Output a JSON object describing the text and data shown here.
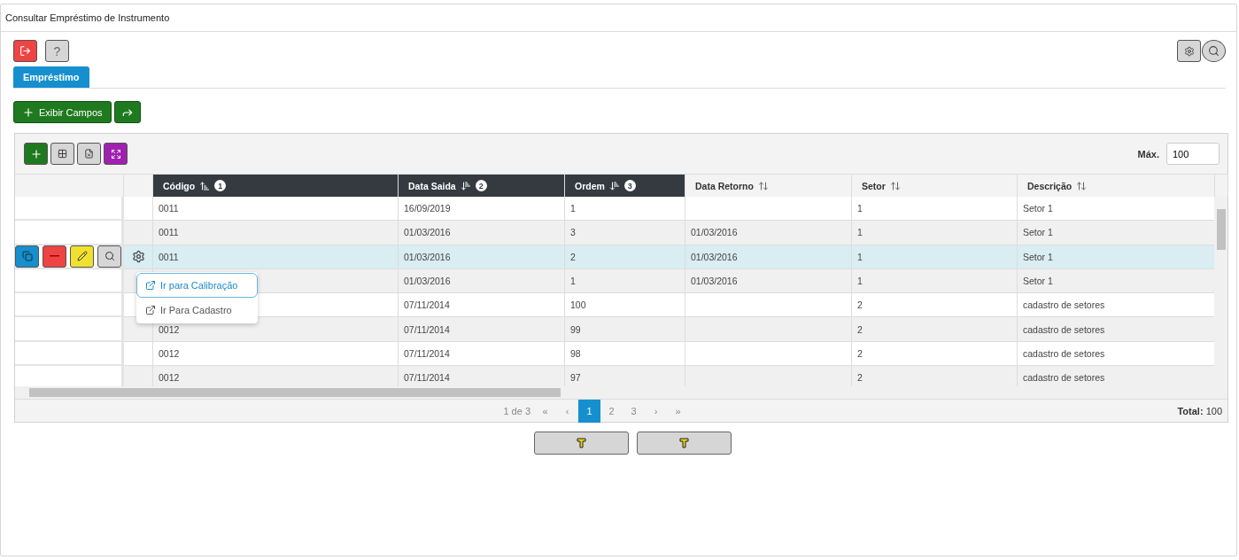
{
  "window": {
    "title": "Consultar Empréstimo de Instrumento"
  },
  "top_toolbar": {
    "help_label": "?"
  },
  "tabs": [
    {
      "label": "Empréstimo",
      "selected": true
    }
  ],
  "actions": {
    "show_fields_label": "Exibir Campos"
  },
  "grid": {
    "max_label": "Máx.",
    "max_value": "100",
    "columns": [
      {
        "label": "Código",
        "sorted": true,
        "descending": false,
        "order": "1"
      },
      {
        "label": "Data Saida",
        "sorted": true,
        "descending": true,
        "order": "2"
      },
      {
        "label": "Ordem",
        "sorted": true,
        "descending": true,
        "order": "3"
      },
      {
        "label": "Data Retorno",
        "sorted": false
      },
      {
        "label": "Setor",
        "sorted": false
      },
      {
        "label": "Descrição",
        "sorted": false
      }
    ],
    "rows": [
      {
        "selected": false,
        "menu_open": false,
        "cells": [
          "0011",
          "16/09/2019",
          "1",
          null,
          "1",
          "Setor 1"
        ]
      },
      {
        "selected": false,
        "menu_open": false,
        "cells": [
          "0011",
          "01/03/2016",
          "3",
          "01/03/2016",
          "1",
          "Setor 1"
        ]
      },
      {
        "selected": true,
        "menu_open": true,
        "cells": [
          "0011",
          "01/03/2016",
          "2",
          "01/03/2016",
          "1",
          "Setor 1"
        ]
      },
      {
        "selected": false,
        "menu_open": false,
        "cells": [
          null,
          "01/03/2016",
          "1",
          "01/03/2016",
          "1",
          "Setor 1"
        ]
      },
      {
        "selected": false,
        "menu_open": false,
        "cells": [
          null,
          "07/11/2014",
          "100",
          null,
          "2",
          "cadastro de setores"
        ]
      },
      {
        "selected": false,
        "menu_open": false,
        "cells": [
          "0012",
          "07/11/2014",
          "99",
          null,
          "2",
          "cadastro de setores"
        ]
      },
      {
        "selected": false,
        "menu_open": false,
        "cells": [
          "0012",
          "07/11/2014",
          "98",
          null,
          "2",
          "cadastro de setores"
        ]
      },
      {
        "selected": false,
        "menu_open": false,
        "cells": [
          "0012",
          "07/11/2014",
          "97",
          null,
          "2",
          "cadastro de setores"
        ]
      }
    ],
    "context_menu": {
      "items": [
        {
          "label": "Ir para Calibração",
          "selected": true
        },
        {
          "label": "Ir Para Cadastro",
          "selected": false
        }
      ]
    },
    "pagination": {
      "summary": "1 de 3",
      "items": [
        {
          "label": "«",
          "selected": false
        },
        {
          "label": "‹",
          "selected": false
        },
        {
          "label": "1",
          "selected": true
        },
        {
          "label": "2",
          "selected": false
        },
        {
          "label": "3",
          "selected": false
        },
        {
          "label": "›",
          "selected": false
        },
        {
          "label": "»",
          "selected": false
        }
      ],
      "total_label": "Total:",
      "total_value": "100"
    }
  }
}
